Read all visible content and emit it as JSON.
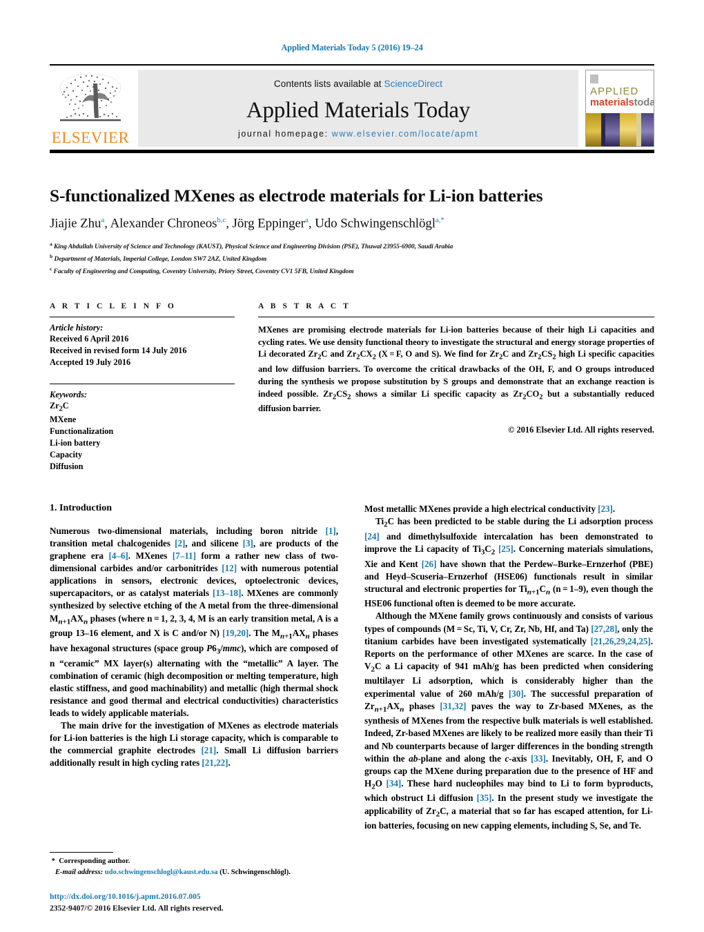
{
  "running_head": "Applied Materials Today 5 (2016) 19–24",
  "masthead": {
    "publisher_name": "ELSEVIER",
    "contents_prefix": "Contents lists available at ",
    "contents_link": "ScienceDirect",
    "journal_title": "Applied Materials Today",
    "homepage_prefix": "journal homepage: ",
    "homepage_url": "www.elsevier.com/locate/apmt",
    "cover": {
      "line1": "APPLIED",
      "line2_a": "materials",
      "line2_b": "today",
      "colors": {
        "applied": "#8e8b3e",
        "materials": "#d2452a",
        "today": "#7d7d7d",
        "gold": "#c9a21a",
        "navy": "#1b1b3a",
        "purple": "#6b5f9e"
      }
    },
    "accent_orange": "#f08a1c",
    "link_blue": "#2b7bb9"
  },
  "article": {
    "title": "S-functionalized MXenes as electrode materials for Li-ion batteries",
    "authors_html": "Jiajie Zhu<sup>a</sup>, Alexander Chroneos<sup>b,c</sup>, Jörg Eppinger<sup>a</sup>, Udo Schwingenschlögl<sup>a,*</sup>",
    "affiliations": [
      {
        "marker": "a",
        "text": "King Abdullah University of Science and Technology (KAUST), Physical Science and Engineering Division (PSE), Thuwal 23955-6900, Saudi Arabia"
      },
      {
        "marker": "b",
        "text": "Department of Materials, Imperial College, London SW7 2AZ, United Kingdom"
      },
      {
        "marker": "c",
        "text": "Faculty of Engineering and Computing, Coventry University, Priory Street, Coventry CV1 5FB, United Kingdom"
      }
    ]
  },
  "article_info": {
    "heading": "A R T I C L E   I N F O",
    "history_title": "Article history:",
    "history": [
      "Received 6 April 2016",
      "Received in revised form 14 July 2016",
      "Accepted 19 July 2016"
    ],
    "keywords_title": "Keywords:",
    "keywords_html": [
      "Zr<sub>2</sub>C",
      "MXene",
      "Functionalization",
      "Li-ion battery",
      "Capacity",
      "Diffusion"
    ]
  },
  "abstract": {
    "heading": "A B S T R A C T",
    "body_html": "MXenes are promising electrode materials for Li-ion batteries because of their high Li capacities and cycling rates. We use density functional theory to investigate the structural and energy storage properties of Li decorated Zr<sub>2</sub>C and Zr<sub>2</sub>CX<sub>2</sub> (X&#8201;=&#8201;F, O and S). We find for Zr<sub>2</sub>C and Zr<sub>2</sub>CS<sub>2</sub> high Li specific capacities and low diffusion barriers. To overcome the critical drawbacks of the OH, F, and O groups introduced during the synthesis we propose substitution by S groups and demonstrate that an exchange reaction is indeed possible. Zr<sub>2</sub>CS<sub>2</sub> shows a similar Li specific capacity as Zr<sub>2</sub>CO<sub>2</sub> but a substantially reduced diffusion barrier.",
    "copyright": "© 2016 Elsevier Ltd. All rights reserved."
  },
  "introduction": {
    "heading": "1.  Introduction",
    "left_paragraphs_html": [
      "Numerous two-dimensional materials, including boron nitride <span class=\"ref\">[1]</span>, transition metal chalcogenides <span class=\"ref\">[2]</span>, and silicene <span class=\"ref\">[3]</span>, are products of the graphene era <span class=\"ref\">[4–6]</span>. MXenes <span class=\"ref\">[7–11]</span> form a rather new class of two-dimensional carbides and/or carbonitrides <span class=\"ref\">[12]</span> with numerous potential applications in sensors, electronic devices, optoelectronic devices, supercapacitors, or as catalyst materials <span class=\"ref\">[13–18]</span>. MXenes are commonly synthesized by selective etching of the A metal from the three-dimensional M<sub><i>n</i>+1</sub>AX<sub><i>n</i></sub> phases (where n&#8201;=&#8201;1, 2, 3, 4, M is an early transition metal, A is a group 13–16 element, and X is C and/or N) <span class=\"ref\">[19,20]</span>. The M<sub><i>n</i>+1</sub>AX<sub><i>n</i></sub> phases have hexagonal structures (space group <i>P</i>6<sub>3</sub>/<i>mmc</i>), which are composed of n “ceramic” MX layer(s) alternating with the “metallic” A layer. The combination of ceramic (high decomposition or melting temperature, high elastic stiffness, and good machinability) and metallic (high thermal shock resistance and good thermal and electrical conductivities) characteristics leads to widely applicable materials.",
      "The main drive for the investigation of MXenes as electrode materials for Li-ion batteries is the high Li storage capacity, which is comparable to the commercial graphite electrodes <span class=\"ref\">[21]</span>. Small Li diffusion barriers additionally result in high cycling rates <span class=\"ref\">[21,22]</span>."
    ],
    "right_paragraphs_html": [
      "Most metallic MXenes provide a high electrical conductivity <span class=\"ref\">[23]</span>.",
      "Ti<sub>2</sub>C has been predicted to be stable during the Li adsorption process <span class=\"ref\">[24]</span> and dimethylsulfoxide intercalation has been demonstrated to improve the Li capacity of Ti<sub>3</sub>C<sub>2</sub> <span class=\"ref\">[25]</span>. Concerning materials simulations, Xie and Kent <span class=\"ref\">[26]</span> have shown that the Perdew–Burke–Ernzerhof (PBE) and Heyd–Scuseria–Ernzerhof (HSE06) functionals result in similar structural and electronic properties for Ti<sub><i>n</i>+1</sub>C<sub><i>n</i></sub> (n&#8201;=&#8201;1–9), even though the HSE06 functional often is deemed to be more accurate.",
      "Although the MXene family grows continuously and consists of various types of compounds (M&#8201;=&#8201;Sc, Ti, V, Cr, Zr, Nb, Hf, and Ta) <span class=\"ref\">[27,28]</span>, only the titanium carbides have been investigated systematically <span class=\"ref\">[21,26,29,24,25]</span>. Reports on the performance of other MXenes are scarce. In the case of V<sub>2</sub>C a Li capacity of 941 mAh/g has been predicted when considering multilayer Li adsorption, which is considerably higher than the experimental value of 260 mAh/g <span class=\"ref\">[30]</span>. The successful preparation of Zr<sub><i>n</i>+1</sub>AX<sub><i>n</i></sub> phases <span class=\"ref\">[31,32]</span> paves the way to Zr-based MXenes, as the synthesis of MXenes from the respective bulk materials is well established. Indeed, Zr-based MXenes are likely to be realized more easily than their Ti and Nb counterparts because of larger differences in the bonding strength within the <i>ab</i>-plane and along the <i>c</i>-axis <span class=\"ref\">[33]</span>. Inevitably, OH, F, and O groups cap the MXene during preparation due to the presence of HF and H<sub>2</sub>O <span class=\"ref\">[34]</span>. These hard nucleophiles may bind to Li to form byproducts, which obstruct Li diffusion <span class=\"ref\">[35]</span>. In the present study we investigate the applicability of Zr<sub>2</sub>C, a material that so far has escaped attention, for Li-ion batteries, focusing on new capping elements, including S, Se, and Te."
    ]
  },
  "footnote": {
    "corresponding": "Corresponding author.",
    "email_label": "E-mail address:",
    "email": "udo.schwingenschlogl@kaust.edu.sa",
    "email_suffix": "(U. Schwingenschlögl)."
  },
  "footer": {
    "doi": "http://dx.doi.org/10.1016/j.apmt.2016.07.005",
    "issn_copyright": "2352-9407/© 2016 Elsevier Ltd. All rights reserved."
  }
}
